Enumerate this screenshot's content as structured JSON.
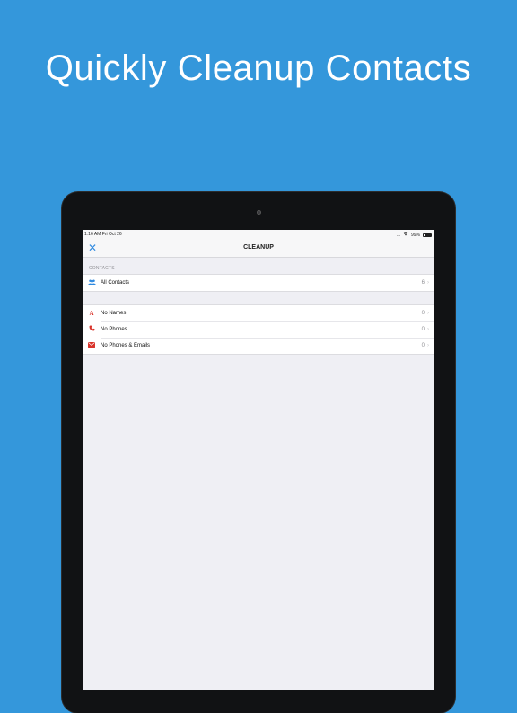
{
  "headline": "Quickly Cleanup Contacts",
  "colors": {
    "background": "#3497db",
    "accent": "#2f8ae0",
    "alert": "#d9342b"
  },
  "status_bar": {
    "time": "1:16 AM  Fri Oct 26",
    "signal": "...",
    "battery": "99%"
  },
  "nav": {
    "close_icon": "close-icon",
    "title": "CLEANUP"
  },
  "contacts_section": {
    "header": "CONTACTS",
    "rows": [
      {
        "icon": "contacts-group-icon",
        "label": "All Contacts",
        "count": "6"
      }
    ]
  },
  "cleanup_section": {
    "rows": [
      {
        "icon": "letter-a-icon",
        "label": "No Names",
        "count": "0"
      },
      {
        "icon": "phone-icon",
        "label": "No Phones",
        "count": "0"
      },
      {
        "icon": "mail-icon",
        "label": "No Phones & Emails",
        "count": "0"
      }
    ]
  }
}
